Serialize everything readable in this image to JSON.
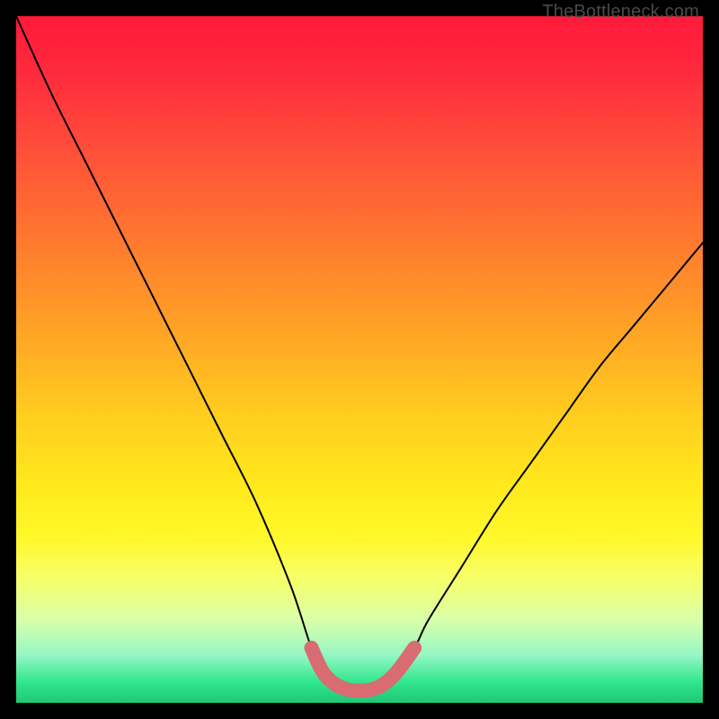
{
  "watermark": "TheBottleneck.com",
  "chart_data": {
    "type": "line",
    "title": "",
    "xlabel": "",
    "ylabel": "",
    "xlim": [
      0,
      100
    ],
    "ylim": [
      0,
      100
    ],
    "series": [
      {
        "name": "bottleneck-curve",
        "x": [
          0,
          5,
          10,
          15,
          20,
          25,
          30,
          35,
          40,
          43,
          45,
          48,
          52,
          55,
          58,
          60,
          65,
          70,
          75,
          80,
          85,
          90,
          95,
          100
        ],
        "values": [
          100,
          89,
          79,
          69,
          59,
          49,
          39,
          29,
          17,
          8,
          4,
          2,
          2,
          4,
          8,
          12,
          20,
          28,
          35,
          42,
          49,
          55,
          61,
          67
        ]
      },
      {
        "name": "flat-bottom-highlight",
        "x": [
          43,
          45,
          48,
          52,
          55,
          58
        ],
        "values": [
          8,
          4,
          2,
          2,
          4,
          8
        ]
      }
    ],
    "colors": {
      "curve": "#000000",
      "highlight": "#d96b72"
    }
  }
}
